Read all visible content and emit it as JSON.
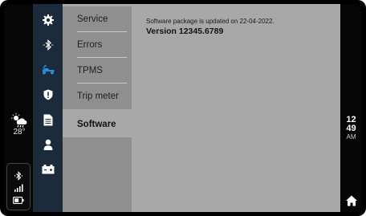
{
  "left_status": {
    "weather_icon": "cloud-sun-rain-icon",
    "temperature": "28°",
    "status_icons": [
      "bluetooth-icon",
      "signal-icon",
      "battery-icon"
    ]
  },
  "rail": {
    "icons": [
      "gear-icon",
      "bluetooth-icon",
      "scooter-icon",
      "shield-icon",
      "document-icon",
      "person-icon",
      "battery-icon"
    ],
    "highlight_color": "#2a8cd6",
    "background": "#1b2b3b"
  },
  "menu": {
    "items": [
      {
        "label": "Service"
      },
      {
        "label": "Errors"
      },
      {
        "label": "TPMS"
      },
      {
        "label": "Trip meter"
      },
      {
        "label": "Software",
        "active": true
      }
    ]
  },
  "content": {
    "message": "Software package is updated on 22-04-2022.",
    "version": "Version 12345.6789"
  },
  "clock": {
    "hours": "12",
    "minutes": "49",
    "ampm": "AM"
  },
  "nav": {
    "home_icon": "home-icon"
  }
}
